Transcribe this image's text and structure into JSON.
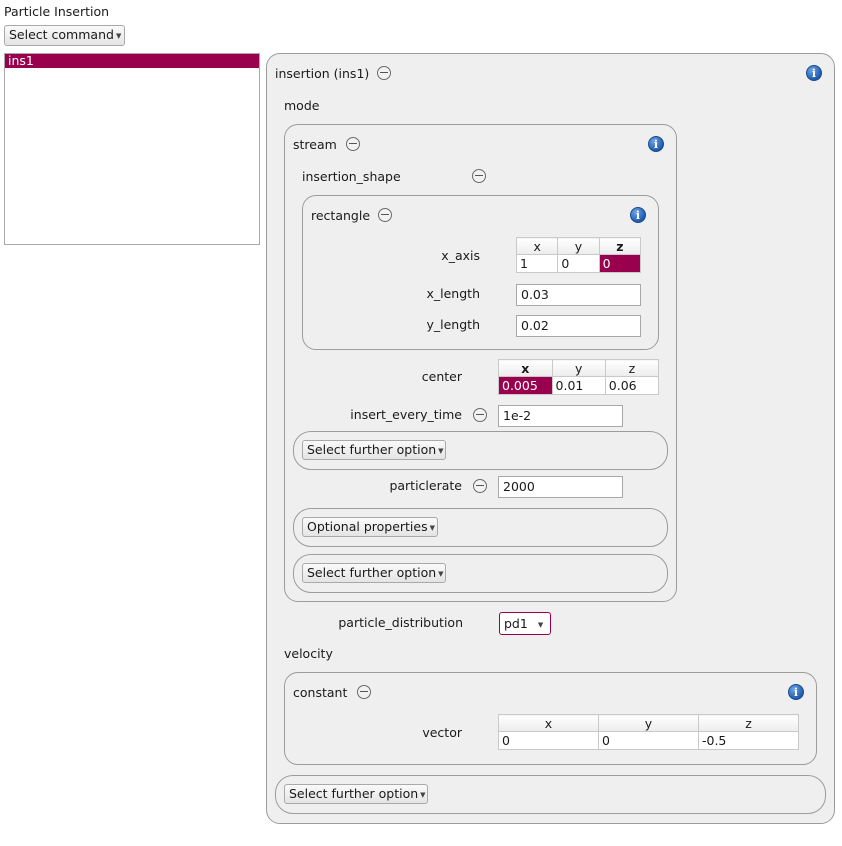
{
  "title": "Particle Insertion",
  "select_command": "Select command",
  "list": {
    "items": [
      "ins1"
    ]
  },
  "insertion": {
    "header": "insertion (ins1)",
    "mode_label": "mode",
    "stream": {
      "header": "stream",
      "insertion_shape_label": "insertion_shape",
      "rectangle": {
        "header": "rectangle",
        "x_axis_label": "x_axis",
        "x_axis_cols": [
          "x",
          "y",
          "z"
        ],
        "x_axis_vals": [
          "1",
          "0",
          "0"
        ],
        "x_length_label": "x_length",
        "x_length_value": "0.03",
        "y_length_label": "y_length",
        "y_length_value": "0.02"
      },
      "center_label": "center",
      "center_cols": [
        "x",
        "y",
        "z"
      ],
      "center_vals": [
        "0.005",
        "0.01",
        "0.06"
      ],
      "insert_every_time_label": "insert_every_time",
      "insert_every_time_value": "1e-2",
      "further_option_1": "Select further option",
      "particlerate_label": "particlerate",
      "particlerate_value": "2000",
      "optional_properties": "Optional properties",
      "further_option_2": "Select further option"
    },
    "particle_distribution_label": "particle_distribution",
    "particle_distribution_value": "pd1",
    "velocity_label": "velocity",
    "constant": {
      "header": "constant",
      "vector_label": "vector",
      "vector_cols": [
        "x",
        "y",
        "z"
      ],
      "vector_vals": [
        "0",
        "0",
        "-0.5"
      ]
    },
    "further_option_3": "Select further option"
  },
  "colors": {
    "selection": "#99004d",
    "info": "#1f5db0",
    "panel": "#efefef"
  }
}
